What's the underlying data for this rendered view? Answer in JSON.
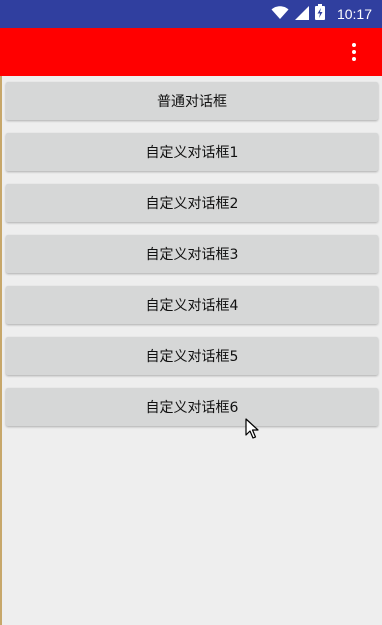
{
  "status_bar": {
    "time": "10:17",
    "background": "#303f9f"
  },
  "app_bar": {
    "background": "#ff0000",
    "overflow_icon": "more-vert-icon"
  },
  "buttons": [
    {
      "label": "普通对话框"
    },
    {
      "label": "自定义对话框1"
    },
    {
      "label": "自定义对话框2"
    },
    {
      "label": "自定义对话框3"
    },
    {
      "label": "自定义对话框4"
    },
    {
      "label": "自定义对话框5"
    },
    {
      "label": "自定义对话框6"
    }
  ]
}
